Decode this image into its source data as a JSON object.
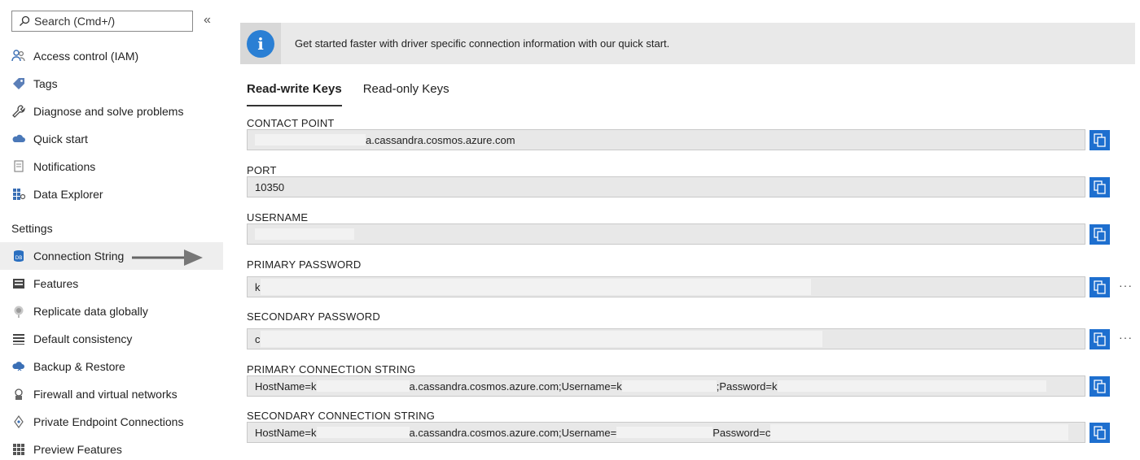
{
  "sidebar": {
    "search_placeholder": "Search (Cmd+/)",
    "collapse_glyph": "«",
    "items": [
      {
        "label": "Access control (IAM)",
        "icon": "people-icon"
      },
      {
        "label": "Tags",
        "icon": "tag-icon"
      },
      {
        "label": "Diagnose and solve problems",
        "icon": "wrench-icon"
      },
      {
        "label": "Quick start",
        "icon": "cloud-icon"
      },
      {
        "label": "Notifications",
        "icon": "notification-icon"
      },
      {
        "label": "Data Explorer",
        "icon": "data-explorer-icon"
      }
    ],
    "settings_header": "Settings",
    "settings_items": [
      {
        "label": "Connection String",
        "icon": "database-icon",
        "selected": true
      },
      {
        "label": "Features",
        "icon": "features-icon"
      },
      {
        "label": "Replicate data globally",
        "icon": "globe-icon"
      },
      {
        "label": "Default consistency",
        "icon": "consistency-icon"
      },
      {
        "label": "Backup & Restore",
        "icon": "backup-icon"
      },
      {
        "label": "Firewall and virtual networks",
        "icon": "firewall-icon"
      },
      {
        "label": "Private Endpoint Connections",
        "icon": "endpoint-icon"
      },
      {
        "label": "Preview Features",
        "icon": "grid-icon"
      }
    ]
  },
  "banner": {
    "message": "Get started faster with driver specific connection information with our quick start."
  },
  "tabs": [
    {
      "label": "Read-write Keys",
      "active": true
    },
    {
      "label": "Read-only Keys",
      "active": false
    }
  ],
  "fields": {
    "contact_point": {
      "label": "CONTACT POINT",
      "value": "a.cassandra.cosmos.azure.com"
    },
    "port": {
      "label": "PORT",
      "value": "10350"
    },
    "username": {
      "label": "USERNAME",
      "value": ""
    },
    "primary_password": {
      "label": "PRIMARY PASSWORD",
      "value": "k"
    },
    "secondary_password": {
      "label": "SECONDARY PASSWORD",
      "value": "c"
    },
    "primary_conn": {
      "label": "PRIMARY CONNECTION STRING",
      "prefix": "HostName=k",
      "mid1": "a.cassandra.cosmos.azure.com;Username=k",
      "mid2": ";Password=k"
    },
    "secondary_conn": {
      "label": "SECONDARY CONNECTION STRING",
      "prefix": "HostName=k",
      "mid1": "a.cassandra.cosmos.azure.com;Username=",
      "mid2": "Password=c"
    }
  },
  "colors": {
    "accent": "#1e6fcf",
    "banner_bg": "#e9e9e9",
    "field_bg": "#e8e8e8"
  }
}
